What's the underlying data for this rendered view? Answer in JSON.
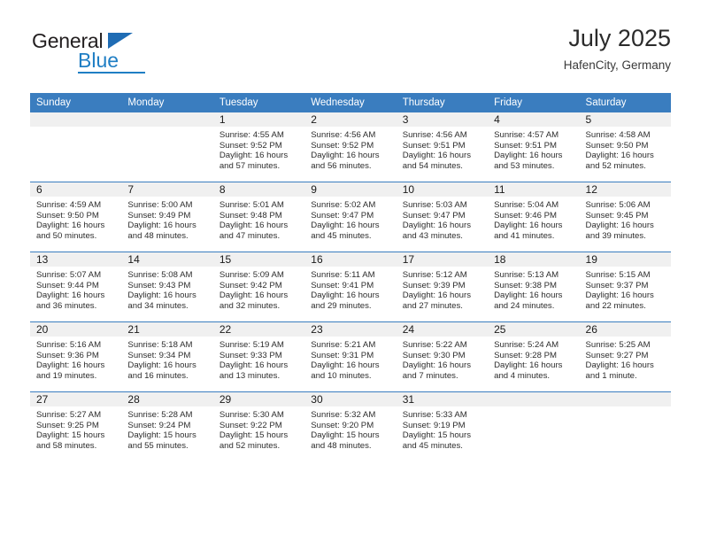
{
  "brand": {
    "name_part1": "General",
    "name_part2": "Blue",
    "triangle_color": "#1f6cb4",
    "blue_color": "#1f7ec4"
  },
  "header": {
    "title": "July 2025",
    "location": "HafenCity, Germany"
  },
  "theme": {
    "header_blue": "#3a7dbf",
    "daynum_band": "#f0f0f0",
    "cell_bg": "#ffffff",
    "text": "#2d2d2d"
  },
  "weekday_headers": [
    "Sunday",
    "Monday",
    "Tuesday",
    "Wednesday",
    "Thursday",
    "Friday",
    "Saturday"
  ],
  "labels": {
    "sunrise_prefix": "Sunrise:",
    "sunset_prefix": "Sunset:",
    "daylight_prefix": "Daylight:"
  },
  "weeks": [
    [
      {
        "day": "",
        "sunrise": "",
        "sunset": "",
        "daylight": ""
      },
      {
        "day": "",
        "sunrise": "",
        "sunset": "",
        "daylight": ""
      },
      {
        "day": "1",
        "sunrise": "Sunrise: 4:55 AM",
        "sunset": "Sunset: 9:52 PM",
        "daylight": "Daylight: 16 hours and 57 minutes."
      },
      {
        "day": "2",
        "sunrise": "Sunrise: 4:56 AM",
        "sunset": "Sunset: 9:52 PM",
        "daylight": "Daylight: 16 hours and 56 minutes."
      },
      {
        "day": "3",
        "sunrise": "Sunrise: 4:56 AM",
        "sunset": "Sunset: 9:51 PM",
        "daylight": "Daylight: 16 hours and 54 minutes."
      },
      {
        "day": "4",
        "sunrise": "Sunrise: 4:57 AM",
        "sunset": "Sunset: 9:51 PM",
        "daylight": "Daylight: 16 hours and 53 minutes."
      },
      {
        "day": "5",
        "sunrise": "Sunrise: 4:58 AM",
        "sunset": "Sunset: 9:50 PM",
        "daylight": "Daylight: 16 hours and 52 minutes."
      }
    ],
    [
      {
        "day": "6",
        "sunrise": "Sunrise: 4:59 AM",
        "sunset": "Sunset: 9:50 PM",
        "daylight": "Daylight: 16 hours and 50 minutes."
      },
      {
        "day": "7",
        "sunrise": "Sunrise: 5:00 AM",
        "sunset": "Sunset: 9:49 PM",
        "daylight": "Daylight: 16 hours and 48 minutes."
      },
      {
        "day": "8",
        "sunrise": "Sunrise: 5:01 AM",
        "sunset": "Sunset: 9:48 PM",
        "daylight": "Daylight: 16 hours and 47 minutes."
      },
      {
        "day": "9",
        "sunrise": "Sunrise: 5:02 AM",
        "sunset": "Sunset: 9:47 PM",
        "daylight": "Daylight: 16 hours and 45 minutes."
      },
      {
        "day": "10",
        "sunrise": "Sunrise: 5:03 AM",
        "sunset": "Sunset: 9:47 PM",
        "daylight": "Daylight: 16 hours and 43 minutes."
      },
      {
        "day": "11",
        "sunrise": "Sunrise: 5:04 AM",
        "sunset": "Sunset: 9:46 PM",
        "daylight": "Daylight: 16 hours and 41 minutes."
      },
      {
        "day": "12",
        "sunrise": "Sunrise: 5:06 AM",
        "sunset": "Sunset: 9:45 PM",
        "daylight": "Daylight: 16 hours and 39 minutes."
      }
    ],
    [
      {
        "day": "13",
        "sunrise": "Sunrise: 5:07 AM",
        "sunset": "Sunset: 9:44 PM",
        "daylight": "Daylight: 16 hours and 36 minutes."
      },
      {
        "day": "14",
        "sunrise": "Sunrise: 5:08 AM",
        "sunset": "Sunset: 9:43 PM",
        "daylight": "Daylight: 16 hours and 34 minutes."
      },
      {
        "day": "15",
        "sunrise": "Sunrise: 5:09 AM",
        "sunset": "Sunset: 9:42 PM",
        "daylight": "Daylight: 16 hours and 32 minutes."
      },
      {
        "day": "16",
        "sunrise": "Sunrise: 5:11 AM",
        "sunset": "Sunset: 9:41 PM",
        "daylight": "Daylight: 16 hours and 29 minutes."
      },
      {
        "day": "17",
        "sunrise": "Sunrise: 5:12 AM",
        "sunset": "Sunset: 9:39 PM",
        "daylight": "Daylight: 16 hours and 27 minutes."
      },
      {
        "day": "18",
        "sunrise": "Sunrise: 5:13 AM",
        "sunset": "Sunset: 9:38 PM",
        "daylight": "Daylight: 16 hours and 24 minutes."
      },
      {
        "day": "19",
        "sunrise": "Sunrise: 5:15 AM",
        "sunset": "Sunset: 9:37 PM",
        "daylight": "Daylight: 16 hours and 22 minutes."
      }
    ],
    [
      {
        "day": "20",
        "sunrise": "Sunrise: 5:16 AM",
        "sunset": "Sunset: 9:36 PM",
        "daylight": "Daylight: 16 hours and 19 minutes."
      },
      {
        "day": "21",
        "sunrise": "Sunrise: 5:18 AM",
        "sunset": "Sunset: 9:34 PM",
        "daylight": "Daylight: 16 hours and 16 minutes."
      },
      {
        "day": "22",
        "sunrise": "Sunrise: 5:19 AM",
        "sunset": "Sunset: 9:33 PM",
        "daylight": "Daylight: 16 hours and 13 minutes."
      },
      {
        "day": "23",
        "sunrise": "Sunrise: 5:21 AM",
        "sunset": "Sunset: 9:31 PM",
        "daylight": "Daylight: 16 hours and 10 minutes."
      },
      {
        "day": "24",
        "sunrise": "Sunrise: 5:22 AM",
        "sunset": "Sunset: 9:30 PM",
        "daylight": "Daylight: 16 hours and 7 minutes."
      },
      {
        "day": "25",
        "sunrise": "Sunrise: 5:24 AM",
        "sunset": "Sunset: 9:28 PM",
        "daylight": "Daylight: 16 hours and 4 minutes."
      },
      {
        "day": "26",
        "sunrise": "Sunrise: 5:25 AM",
        "sunset": "Sunset: 9:27 PM",
        "daylight": "Daylight: 16 hours and 1 minute."
      }
    ],
    [
      {
        "day": "27",
        "sunrise": "Sunrise: 5:27 AM",
        "sunset": "Sunset: 9:25 PM",
        "daylight": "Daylight: 15 hours and 58 minutes."
      },
      {
        "day": "28",
        "sunrise": "Sunrise: 5:28 AM",
        "sunset": "Sunset: 9:24 PM",
        "daylight": "Daylight: 15 hours and 55 minutes."
      },
      {
        "day": "29",
        "sunrise": "Sunrise: 5:30 AM",
        "sunset": "Sunset: 9:22 PM",
        "daylight": "Daylight: 15 hours and 52 minutes."
      },
      {
        "day": "30",
        "sunrise": "Sunrise: 5:32 AM",
        "sunset": "Sunset: 9:20 PM",
        "daylight": "Daylight: 15 hours and 48 minutes."
      },
      {
        "day": "31",
        "sunrise": "Sunrise: 5:33 AM",
        "sunset": "Sunset: 9:19 PM",
        "daylight": "Daylight: 15 hours and 45 minutes."
      },
      {
        "day": "",
        "sunrise": "",
        "sunset": "",
        "daylight": ""
      },
      {
        "day": "",
        "sunrise": "",
        "sunset": "",
        "daylight": ""
      }
    ]
  ]
}
